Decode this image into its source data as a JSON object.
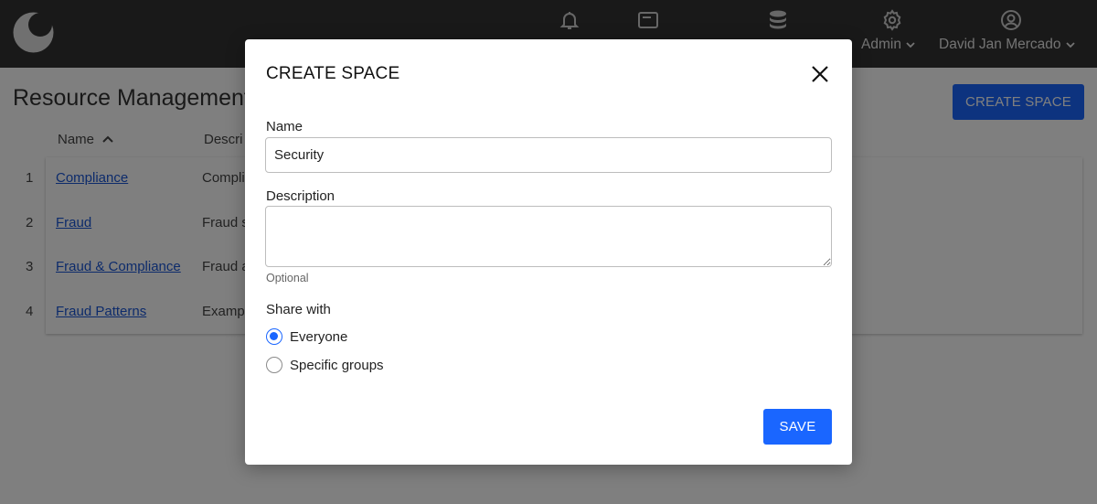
{
  "topbar": {
    "icons": [
      "bell-icon",
      "window-icon",
      "database-icon",
      "gear-icon",
      "account-icon"
    ],
    "admin_label": "Admin",
    "user_label": "David Jan Mercado"
  },
  "page": {
    "title": "Resource Management",
    "create_button_label": "CREATE SPACE",
    "columns": [
      "Name",
      "Descri"
    ],
    "rows": [
      {
        "num": "1",
        "name": "Compliance",
        "desc": "Compli"
      },
      {
        "num": "2",
        "name": "Fraud",
        "desc": "Fraud s"
      },
      {
        "num": "3",
        "name": "Fraud & Compliance",
        "desc": "Fraud a"
      },
      {
        "num": "4",
        "name": "Fraud Patterns",
        "desc": "Examp"
      }
    ]
  },
  "modal": {
    "title": "CREATE SPACE",
    "name_label": "Name",
    "name_value": "Security",
    "description_label": "Description",
    "description_value": "",
    "description_hint": "Optional",
    "share_label": "Share with",
    "share_options": [
      {
        "label": "Everyone",
        "checked": true
      },
      {
        "label": "Specific groups",
        "checked": false
      }
    ],
    "save_label": "SAVE"
  },
  "colors": {
    "accent": "#1a66ff",
    "topbar": "#333333",
    "link": "#1a56d6"
  }
}
